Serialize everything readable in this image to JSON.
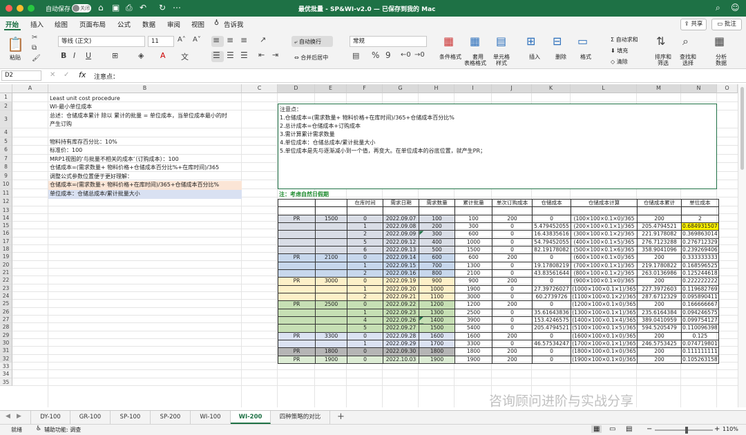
{
  "titlebar": {
    "autosave": "自动保存",
    "toggle": "关闭",
    "title": "最优批量 - SP&WI-v2.0 — 已保存到我的 Mac"
  },
  "menu": [
    "开始",
    "插入",
    "绘图",
    "页面布局",
    "公式",
    "数据",
    "审阅",
    "视图"
  ],
  "tell": "告诉我",
  "share": "共享",
  "comment": "批注",
  "ribbon": {
    "paste": "粘贴",
    "font": "等线 (正文)",
    "size": "11",
    "wrap": "自动换行",
    "merge": "合并后居中",
    "format": "常规",
    "percent": "%",
    "thousands": "9",
    "cond": "条件格式",
    "table1": "套用",
    "table2": "表格格式",
    "cell1": "单元格",
    "cell2": "样式",
    "insert": "插入",
    "delete": "删除",
    "fmt": "格式",
    "autosum": "自动求和",
    "fill": "填充",
    "clear": "清除",
    "sort1": "排序和",
    "sort2": "筛选",
    "find1": "查找和",
    "find2": "选择",
    "analyze1": "分析",
    "analyze2": "数据"
  },
  "formula": {
    "name": "D2",
    "content": "注意点："
  },
  "columns": [
    "A",
    "B",
    "C",
    "D",
    "E",
    "F",
    "G",
    "H",
    "I",
    "J",
    "K",
    "L",
    "M",
    "N",
    "O"
  ],
  "rows": [
    "1",
    "2",
    "3",
    "4",
    "5",
    "6",
    "7",
    "8",
    "9",
    "10",
    "11",
    "12",
    "13",
    "14",
    "15",
    "16",
    "17",
    "18",
    "19",
    "20",
    "21",
    "22",
    "23",
    "24",
    "25",
    "26",
    "27",
    "28",
    "29",
    "30",
    "31",
    "32",
    "33",
    "34",
    "35"
  ],
  "b": {
    "r1": "Least unit cost procedure",
    "r2": "WI-最小单位成本",
    "r3a": "总述：仓储成本累计 除以 累计的批量 = 单位成本，当单位成本最小的时",
    "r3b": "产生订购",
    "r5": "物料持有库存百分比：10%",
    "r6": "标准价：100",
    "r7": "MRP1视图的‘与批量不相关的成本’（订购成本）：100",
    "r8": "仓储成本=(需求数量+ 物料价格+仓储成本百分比%+在库时间)/365",
    "r9": "调整公式参数位置便于更好理解：",
    "r10": "仓储成本=(需求数量+ 物料价格+在库时间)/365+仓储成本百分比%",
    "r11": "单位成本：仓储总成本/累计批量大小"
  },
  "notes": [
    "注意点：",
    "1.仓储成本=(需求数量+ 物料价格+在库时间)/365+仓储成本百分比%",
    "2.总计成本=仓储成本+订购成本",
    "3.需计算累计需求数量",
    "4.单位成本：仓储总成本/累计批量大小",
    "5.单位成本是先与逐渐减小到一个值，再变大。在单位成本的谷底位置，就产生PR；"
  ],
  "note_title": "注：考虑自然日假期",
  "table_header": [
    "",
    "",
    "在库时间",
    "需求日期",
    "需求数量",
    "累计批量",
    "单次订购成本",
    "仓储成本",
    "仓储成本计算",
    "仓储成本累计",
    "单位成本"
  ],
  "table_rows": [
    [
      "",
      "",
      "",
      "",
      "",
      "",
      "",
      "",
      "",
      "",
      ""
    ],
    [
      "PR",
      "1500",
      "0",
      "2022.09.07",
      "100",
      "100",
      "200",
      "0",
      "(100×100×0.1×0)/365",
      "200",
      "2"
    ],
    [
      "",
      "",
      "1",
      "2022.09.08",
      "200",
      "300",
      "0",
      "5.479452055",
      "(200×100×0.1×1)/365",
      "205.4794521",
      "0.684931507"
    ],
    [
      "",
      "",
      "2",
      "2022.09.09",
      "300",
      "600",
      "0",
      "16.43835616",
      "(300×100×0.1×2)/365",
      "221.9178082",
      "0.369863014"
    ],
    [
      "",
      "",
      "5",
      "2022.09.12",
      "400",
      "1000",
      "0",
      "54.79452055",
      "(400×100×0.1×5)/365",
      "276.7123288",
      "0.276712329"
    ],
    [
      "",
      "",
      "6",
      "2022.09.13",
      "500",
      "1500",
      "0",
      "82.19178082",
      "(500×100×0.1×6)/365",
      "358.9041096",
      "0.239269406"
    ],
    [
      "PR",
      "2100",
      "0",
      "2022.09.14",
      "600",
      "600",
      "200",
      "0",
      "(600×100×0.1×0)/365",
      "200",
      "0.333333333"
    ],
    [
      "",
      "",
      "1",
      "2022.09.15",
      "700",
      "1300",
      "0",
      "19.17808219",
      "(700×100×0.1×1)/365",
      "219.1780822",
      "0.168596525"
    ],
    [
      "",
      "",
      "2",
      "2022.09.16",
      "800",
      "2100",
      "0",
      "43.83561644",
      "(800×100×0.1×2)/365",
      "263.0136986",
      "0.125244618"
    ],
    [
      "PR",
      "3000",
      "0",
      "2022.09.19",
      "900",
      "900",
      "200",
      "0",
      "(900×100×0.1×0)/365",
      "200",
      "0.222222222"
    ],
    [
      "",
      "",
      "1",
      "2022.09.20",
      "1000",
      "1900",
      "0",
      "27.39726027",
      "(1000×100×0.1×1)/365",
      "227.3972603",
      "0.119682769"
    ],
    [
      "",
      "",
      "2",
      "2022.09.21",
      "1100",
      "3000",
      "0",
      "60.2739726",
      "(1100×100×0.1×2)/365",
      "287.6712329",
      "0.095890411"
    ],
    [
      "PR",
      "2500",
      "0",
      "2022.09.22",
      "1200",
      "1200",
      "200",
      "0",
      "(1200×100×0.1×0)/365",
      "200",
      "0.166666667"
    ],
    [
      "",
      "",
      "1",
      "2022.09.23",
      "1300",
      "2500",
      "0",
      "35.61643836",
      "(1300×100×0.1×1)/365",
      "235.6164384",
      "0.094246575"
    ],
    [
      "",
      "",
      "4",
      "2022.09.26",
      "1400",
      "3900",
      "0",
      "153.4246575",
      "(1400×100×0.1×4)/365",
      "389.0410959",
      "0.099754127"
    ],
    [
      "",
      "",
      "5",
      "2022.09.27",
      "1500",
      "5400",
      "0",
      "205.4794521",
      "(5100×100×0.1×5)/365",
      "594.5205479",
      "0.110096398"
    ],
    [
      "PR",
      "3300",
      "0",
      "2022.09.28",
      "1600",
      "1600",
      "200",
      "0",
      "(1600×100×0.1×0)/365",
      "200",
      "0.125"
    ],
    [
      "",
      "",
      "1",
      "2022.09.29",
      "1700",
      "3300",
      "0",
      "46.57534247",
      "(1700×100×0.1×1)/365",
      "246.5753425",
      "0.074719801"
    ],
    [
      "PR",
      "1800",
      "0",
      "2022.09.30",
      "1800",
      "1800",
      "200",
      "0",
      "(1800×100×0.1×0)/365",
      "200",
      "0.111111111"
    ],
    [
      "PR",
      "1900",
      "0",
      "2022.10.03",
      "1900",
      "1900",
      "200",
      "0",
      "(1900×100×0.1×0)/365",
      "200",
      "0.105263158"
    ]
  ],
  "sheets": [
    "DY-100",
    "GR-100",
    "SP-100",
    "SP-200",
    "WI-100",
    "WI-200",
    "四种策略的对比"
  ],
  "status": {
    "ready": "就绪",
    "access": "辅助功能: 调查",
    "zoom": "110%"
  },
  "watermark": "咨询顾问进阶与实战分享"
}
